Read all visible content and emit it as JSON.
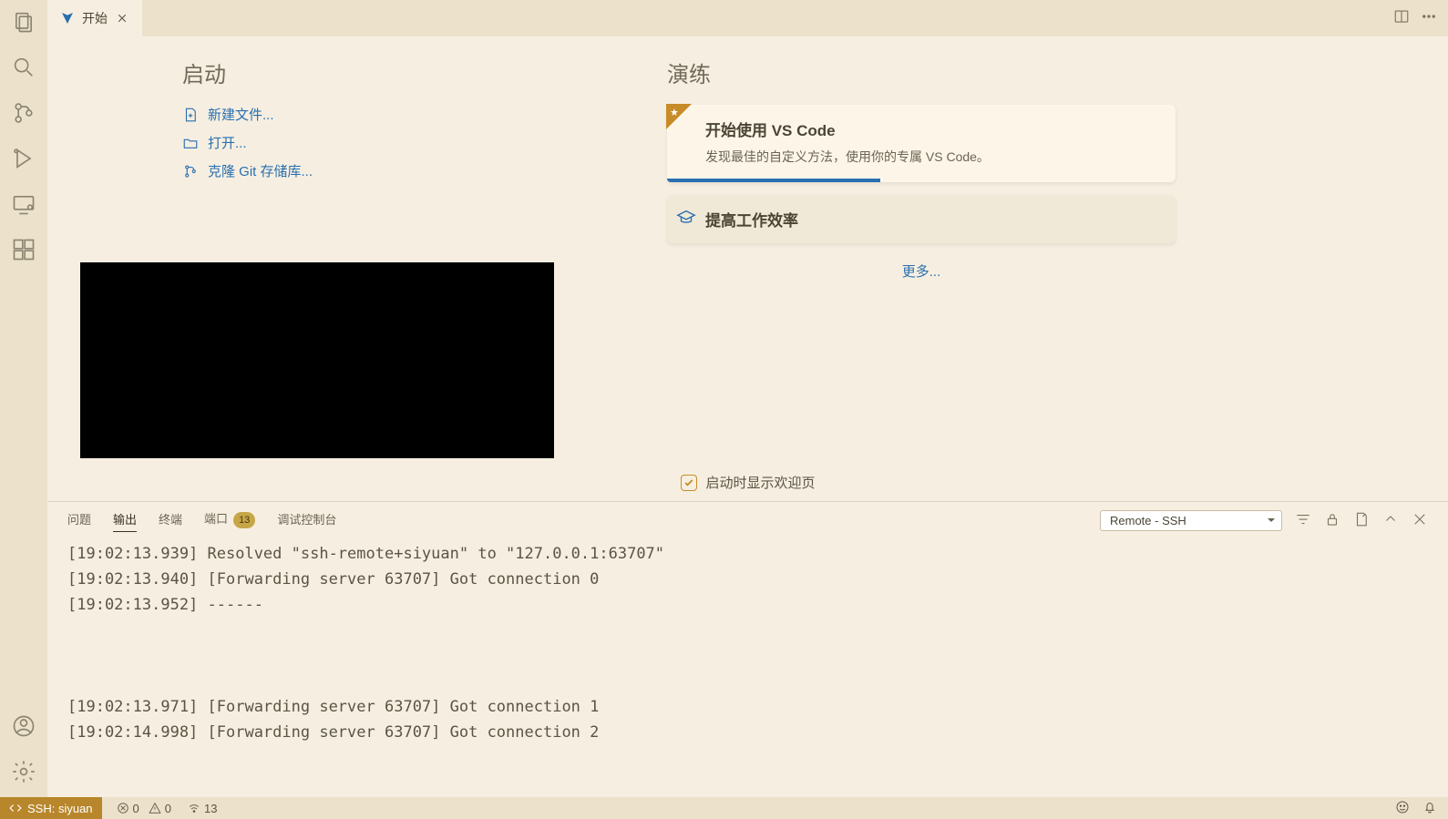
{
  "tabs": {
    "welcome": "开始"
  },
  "welcome": {
    "start_heading": "启动",
    "new_file": "新建文件...",
    "open": "打开...",
    "clone": "克隆 Git 存储库...",
    "walkthrough_heading": "演练",
    "wt1_title": "开始使用 VS Code",
    "wt1_desc": "发现最佳的自定义方法，使用你的专属 VS Code。",
    "wt2_title": "提高工作效率",
    "more": "更多...",
    "show_on_startup": "启动时显示欢迎页"
  },
  "panel": {
    "tabs": {
      "problems": "问题",
      "output": "输出",
      "terminal": "终端",
      "ports": "端口",
      "debug": "调试控制台"
    },
    "ports_badge": "13",
    "channel": "Remote - SSH",
    "lines": [
      "[19:02:13.939] Resolved \"ssh-remote+siyuan\" to \"127.0.0.1:63707\"",
      "[19:02:13.940] [Forwarding server 63707] Got connection 0",
      "[19:02:13.952] ------",
      "",
      "",
      "",
      "[19:02:13.971] [Forwarding server 63707] Got connection 1",
      "[19:02:14.998] [Forwarding server 63707] Got connection 2"
    ]
  },
  "status": {
    "remote": "SSH: siyuan",
    "errors": "0",
    "warnings": "0",
    "ports": "13"
  }
}
